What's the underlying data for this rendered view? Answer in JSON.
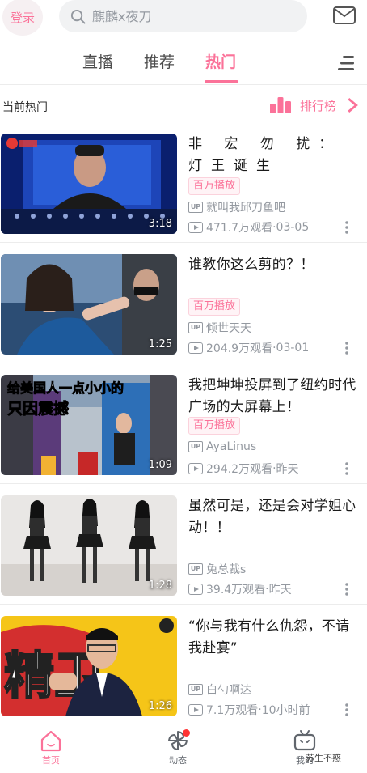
{
  "header": {
    "login_label": "登录",
    "search_placeholder": "麒麟x夜刀",
    "icons": {
      "search": "search-icon",
      "mail": "mail-icon"
    }
  },
  "tabs": [
    {
      "label": "直播",
      "active": false
    },
    {
      "label": "推荐",
      "active": false
    },
    {
      "label": "热门",
      "active": true
    }
  ],
  "section": {
    "title": "当前热门",
    "ranking_label": "排行榜"
  },
  "videos": [
    {
      "title": "非 宏 勿 扰：灯王诞生",
      "badge": "百万播放",
      "uploader": "就叫我邱刀鱼吧",
      "views": "471.7万观看",
      "date": "03-05",
      "duration": "3:18"
    },
    {
      "title": "谁教你这么剪的？！",
      "badge": "百万播放",
      "uploader": "倾世天天",
      "views": "204.9万观看",
      "date": "03-01",
      "duration": "1:25"
    },
    {
      "title": "我把坤坤投屏到了纽约时代广场的大屏幕上！",
      "badge": "百万播放",
      "uploader": "AyaLinus",
      "views": "294.2万观看",
      "date": "昨天",
      "duration": "1:09",
      "thumb_text": "给美国人一点小小的只因震撼"
    },
    {
      "title": "虽然可是，还是会对学姐心动！！",
      "badge": "",
      "uploader": "兔总裁s",
      "views": "39.4万观看",
      "date": "昨天",
      "duration": "1:28"
    },
    {
      "title": "“你与我有什么仇怨，不请我赴宴”",
      "badge": "",
      "uploader": "白勺啊达",
      "views": "7.1万观看",
      "date": "10小时前",
      "duration": "1:26"
    }
  ],
  "upbox_label": "UP",
  "separator": " · ",
  "bottom_nav": [
    {
      "label": "首页",
      "active": true
    },
    {
      "label": "动态",
      "active": false
    },
    {
      "label": "我的",
      "active": false
    }
  ],
  "watermark": "苏生不惑",
  "colors": {
    "accent": "#fb7299",
    "muted": "#9499a0",
    "notify": "#ff3333"
  }
}
